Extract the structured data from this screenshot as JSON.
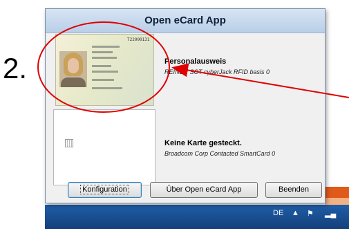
{
  "step_number": "2.",
  "window": {
    "title": "Open eCard App"
  },
  "cards": [
    {
      "title": "Personalausweis",
      "reader": "REINER SCT cyberJack RFID basis 0",
      "inserted": true,
      "id_number": "T22000131"
    },
    {
      "title": "Keine Karte gesteckt.",
      "reader": "Broadcom Corp Contacted SmartCard 0",
      "inserted": false
    }
  ],
  "buttons": [
    {
      "label": "Konfiguration",
      "focused": true
    },
    {
      "label": "Über Open eCard App",
      "focused": false
    },
    {
      "label": "Beenden",
      "focused": false
    }
  ],
  "taskbar": {
    "language": "DE"
  },
  "colors": {
    "annotation": "#e00000",
    "titlebar": "#c5d7ec",
    "taskbar": "#1a4f91"
  }
}
